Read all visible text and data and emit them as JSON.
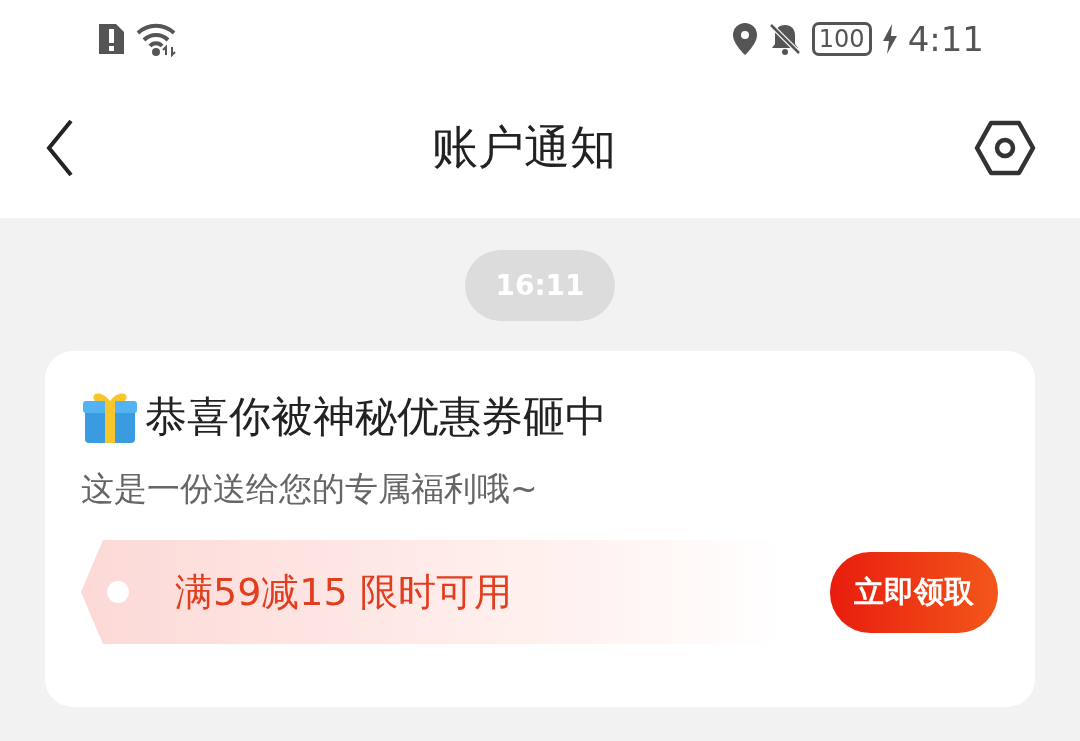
{
  "status_bar": {
    "battery": "100",
    "time": "4:11"
  },
  "nav": {
    "title": "账户通知"
  },
  "timestamp": "16:11",
  "card": {
    "title": "恭喜你被神秘优惠券砸中",
    "subtitle": "这是一份送给您的专属福利哦~",
    "coupon": {
      "text": "满59减15 限时可用",
      "button": "立即领取"
    }
  }
}
